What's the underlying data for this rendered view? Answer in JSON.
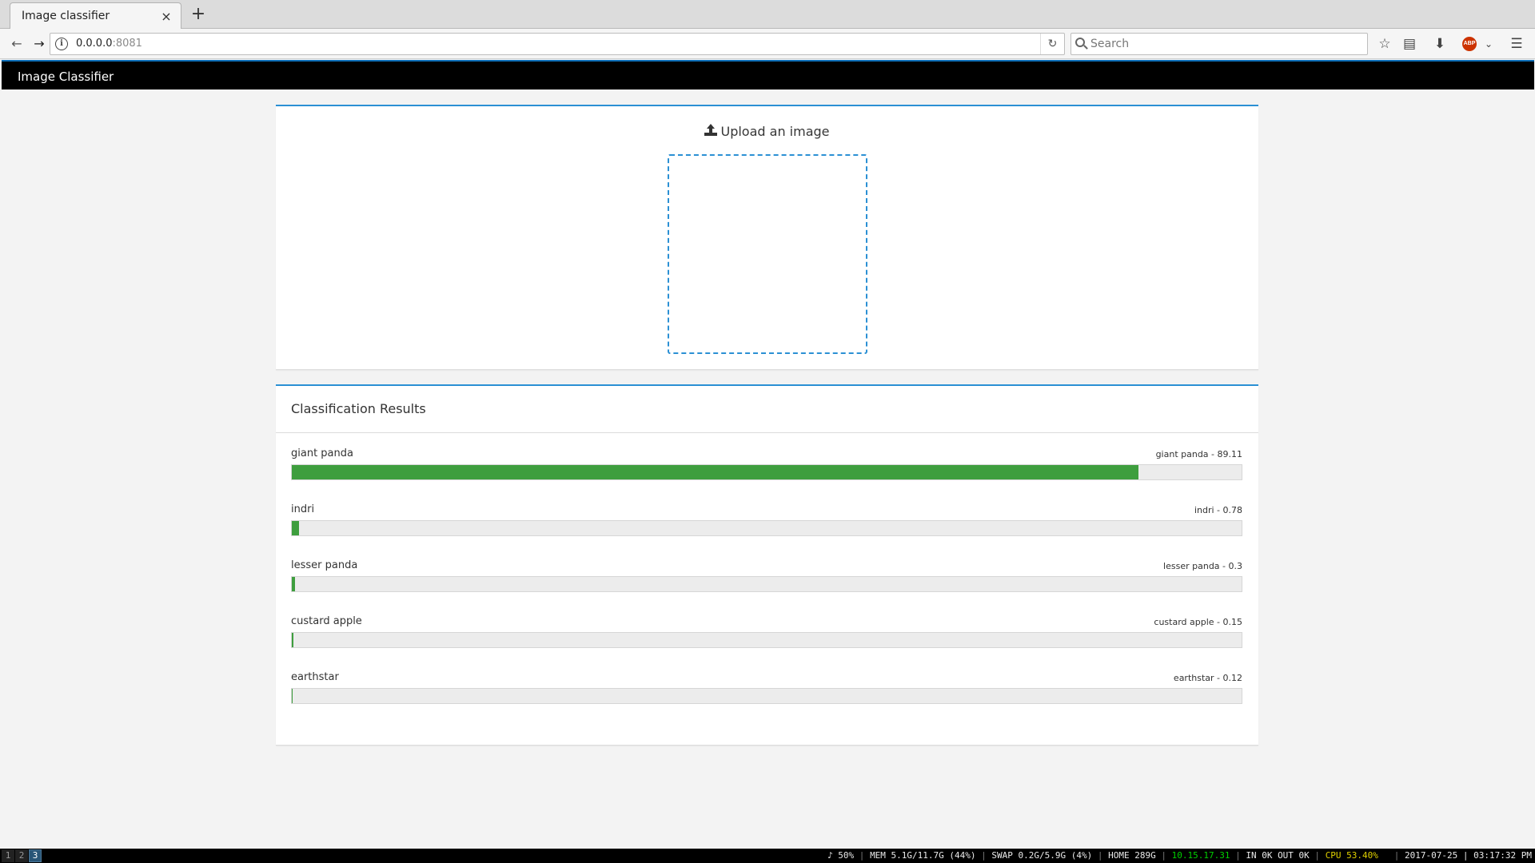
{
  "browser": {
    "tab_title": "Image classifier",
    "tab_close": "×",
    "new_tab": "+",
    "url_host": "0.0.0.0",
    "url_port": ":8081",
    "search_placeholder": "Search",
    "abp_label": "ABP"
  },
  "app": {
    "brand": "Image Classifier"
  },
  "upload": {
    "title": "Upload an image"
  },
  "results": {
    "header": "Classification Results",
    "accent_color": "#3e9e3e",
    "items": [
      {
        "label": "giant panda",
        "value_text": "giant panda - 89.11",
        "percent": 89.11
      },
      {
        "label": "indri",
        "value_text": "indri - 0.78",
        "percent": 0.78
      },
      {
        "label": "lesser panda",
        "value_text": "lesser panda - 0.3",
        "percent": 0.3
      },
      {
        "label": "custard apple",
        "value_text": "custard apple - 0.15",
        "percent": 0.15
      },
      {
        "label": "earthstar",
        "value_text": "earthstar - 0.12",
        "percent": 0.12
      }
    ]
  },
  "statusbar": {
    "workspaces": [
      "1",
      "2",
      "3"
    ],
    "active_workspace": "3",
    "volume": "♪ 50%",
    "mem": "MEM 5.1G/11.7G (44%)",
    "swap": "SWAP 0.2G/5.9G (4%)",
    "home": "HOME 289G",
    "ip": "10.15.17.31",
    "net": "IN 0K OUT 0K",
    "cpu": "CPU 53.40%",
    "datetime": "2017-07-25 | 03:17:32 PM"
  }
}
